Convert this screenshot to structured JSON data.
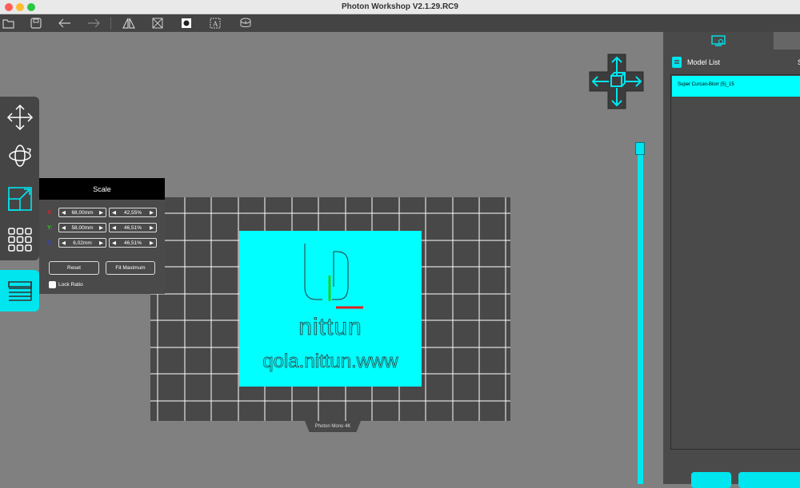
{
  "window": {
    "title": "Photon Workshop V2.1.29.RC9"
  },
  "toolbar": {
    "icons": [
      "folder-open-icon",
      "save-icon",
      "undo-icon",
      "redo-icon",
      "mirror-icon",
      "repair-icon",
      "hollow-icon",
      "text-icon",
      "slice-icon"
    ]
  },
  "tools": [
    "move-icon",
    "rotate-icon",
    "scale-icon",
    "arrange-icon",
    "layers-icon"
  ],
  "scale_panel": {
    "title": "Scale",
    "rows": [
      {
        "axis": "X:",
        "axis_color": "#e02020",
        "size": "68,00mm",
        "percent": "42,55%"
      },
      {
        "axis": "Y:",
        "axis_color": "#20d020",
        "size": "58,00mm",
        "percent": "46,51%"
      },
      {
        "axis": "Z:",
        "axis_color": "#3040e0",
        "size": "6,02mm",
        "percent": "46,51%"
      }
    ],
    "reset_label": "Reset",
    "fit_label": "Fit Maximum",
    "lock_label": "Lock Ratio"
  },
  "plate": {
    "printer_label": "Photon Mono 4K",
    "model_line1": "nittun",
    "model_line2": "qola.nittun.www"
  },
  "right_panel": {
    "model_list_label": "Model List",
    "header_cut": "S",
    "models": [
      "Super Curcan-Blorr (5)_15"
    ]
  },
  "colors": {
    "accent": "#00e5ee",
    "model": "#00ffff"
  }
}
